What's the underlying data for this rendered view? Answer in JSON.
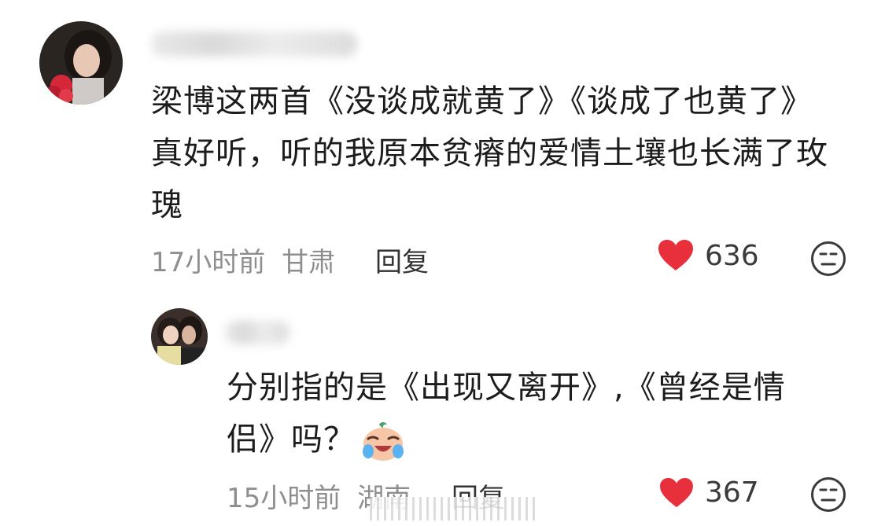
{
  "comments": [
    {
      "text": "梁博这两首《没谈成就黄了》《谈成了也黄了》真好听，听的我原本贫瘠的爱情土壤也长满了玫瑰",
      "time": "17小时前",
      "location": "甘肃",
      "reply_label": "回复",
      "likes": "636"
    },
    {
      "text": "分别指的是《出现又离开》,《曾经是情侣》吗？",
      "time": "15小时前",
      "location": "湖南",
      "reply_label": "回复",
      "likes": "367"
    }
  ],
  "colors": {
    "heart": "#e8303d",
    "meta": "#8e8e8e"
  }
}
